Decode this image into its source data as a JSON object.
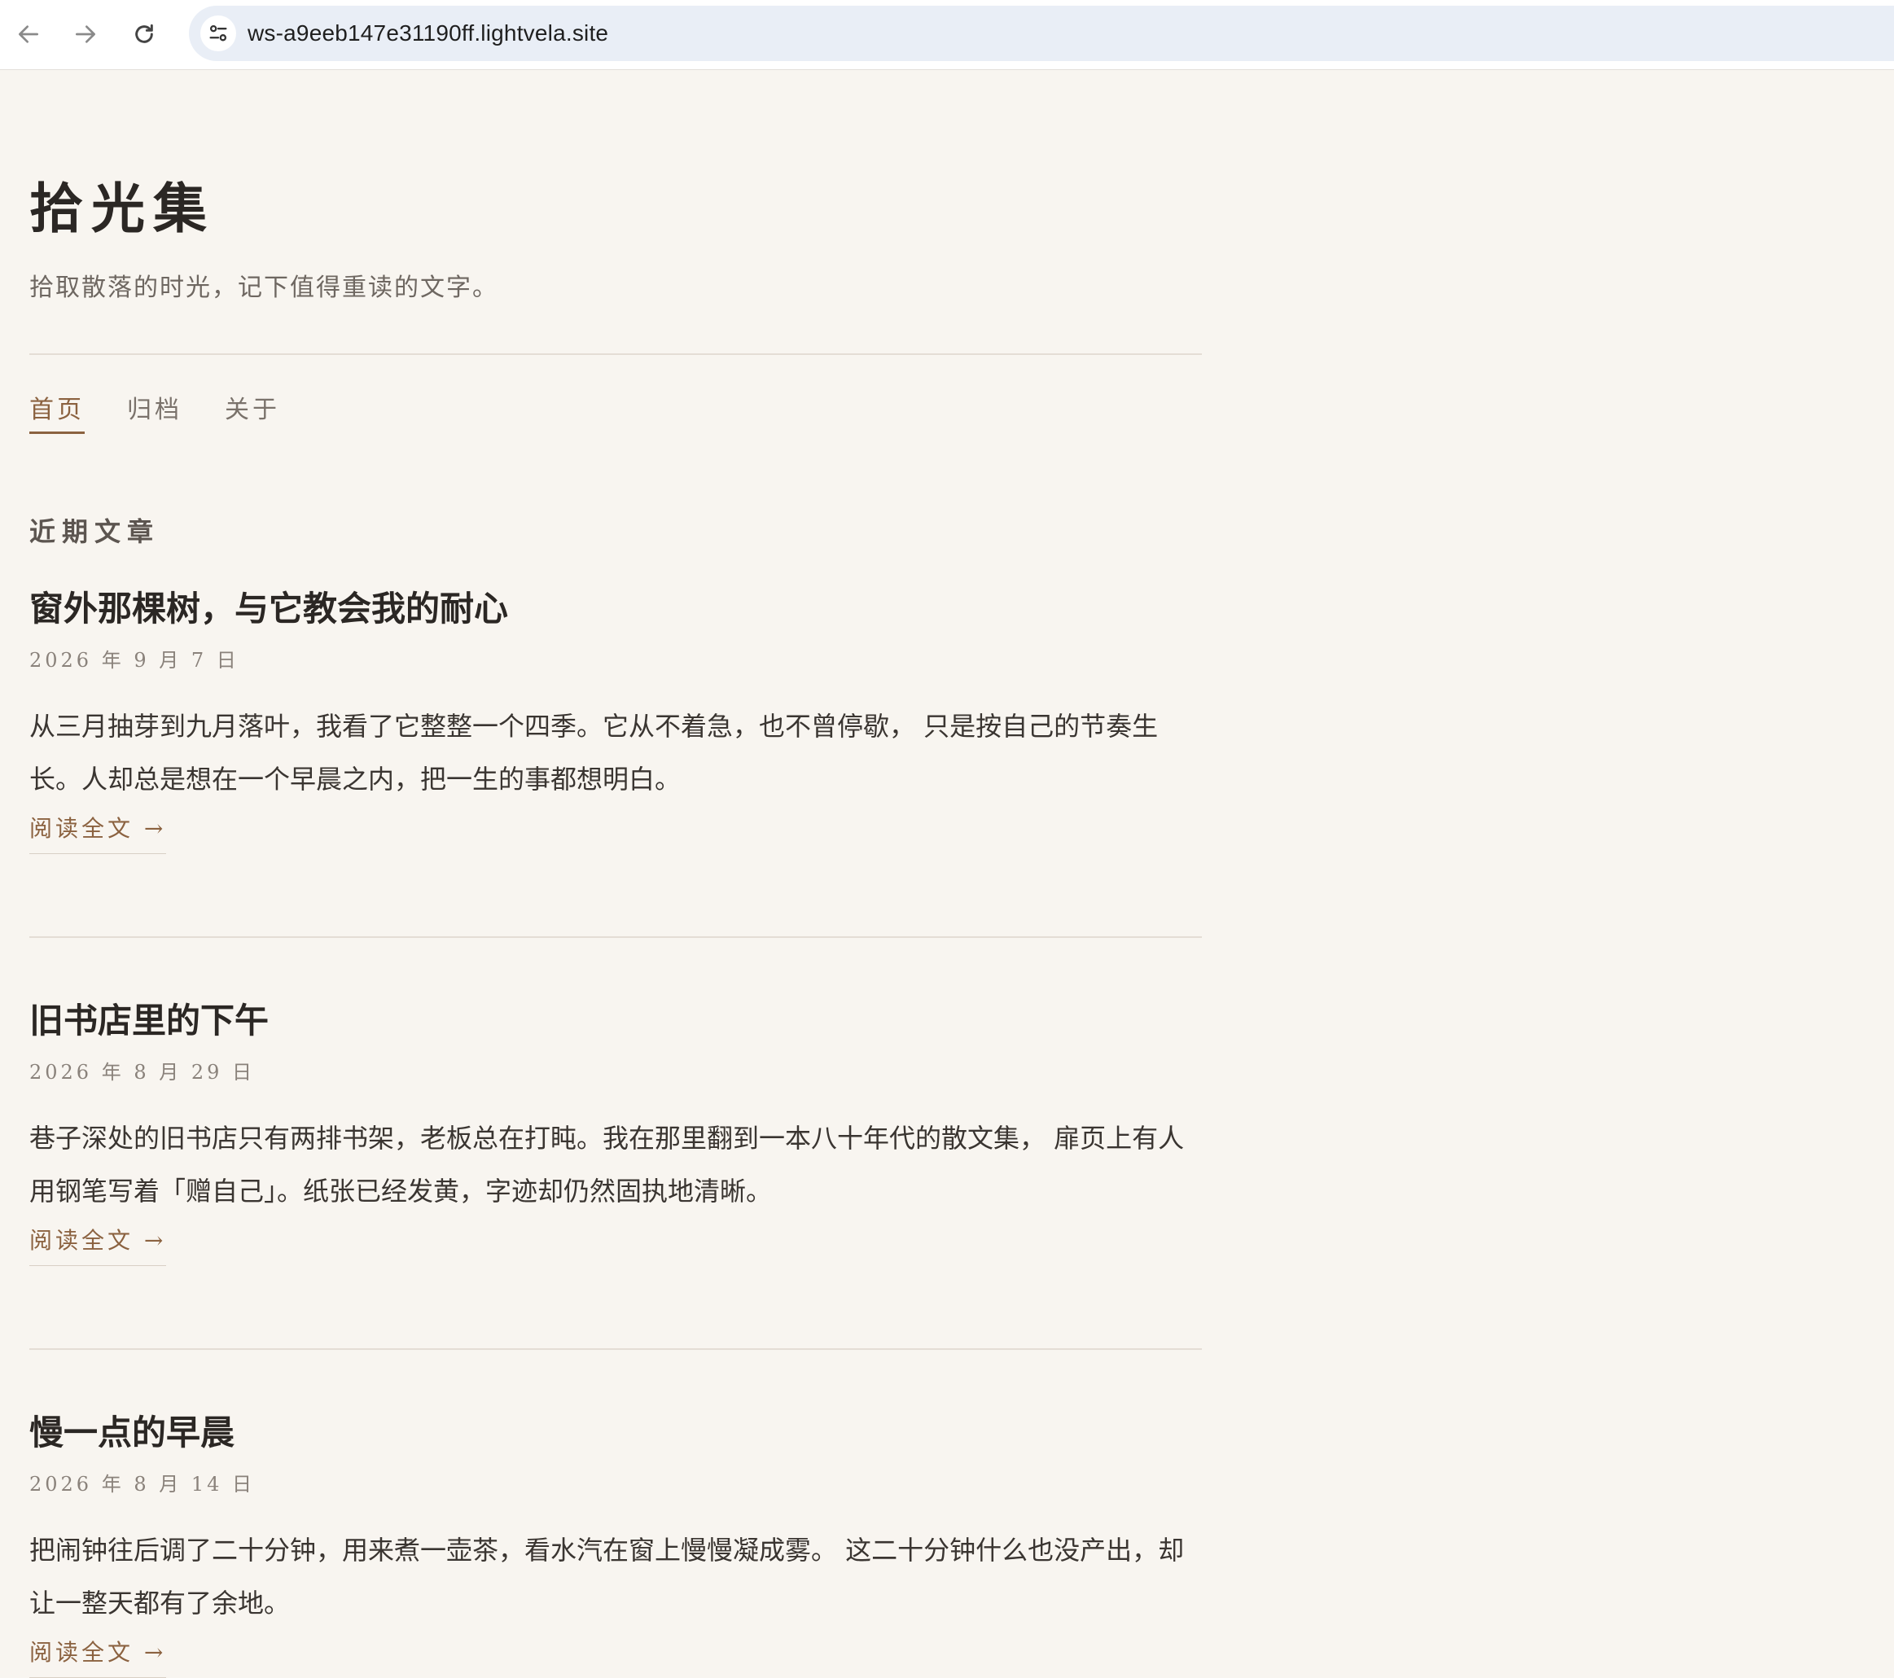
{
  "browser": {
    "url": "ws-a9eeb147e31190ff.lightvela.site"
  },
  "site": {
    "title": "拾光集",
    "tagline": "拾取散落的时光，记下值得重读的文字。"
  },
  "nav": {
    "items": [
      {
        "label": "首页",
        "active": true
      },
      {
        "label": "归档",
        "active": false
      },
      {
        "label": "关于",
        "active": false
      }
    ]
  },
  "section": {
    "heading": "近期文章"
  },
  "posts": [
    {
      "title": "窗外那棵树，与它教会我的耐心",
      "date": "2026 年 9 月 7 日",
      "excerpt": "从三月抽芽到九月落叶，我看了它整整一个四季。它从不着急，也不曾停歇， 只是按自己的节奏生长。人却总是想在一个早晨之内，把一生的事都想明白。",
      "read_more": "阅读全文 →"
    },
    {
      "title": "旧书店里的下午",
      "date": "2026 年 8 月 29 日",
      "excerpt": "巷子深处的旧书店只有两排书架，老板总在打盹。我在那里翻到一本八十年代的散文集， 扉页上有人用钢笔写着「赠自己」。纸张已经发黄，字迹却仍然固执地清晰。",
      "read_more": "阅读全文 →"
    },
    {
      "title": "慢一点的早晨",
      "date": "2026 年 8 月 14 日",
      "excerpt": "把闹钟往后调了二十分钟，用来煮一壶茶，看水汽在窗上慢慢凝成雾。 这二十分钟什么也没产出，却让一整天都有了余地。",
      "read_more": "阅读全文 →"
    }
  ],
  "colors": {
    "background": "#f8f5f0",
    "accent": "#8b6240",
    "text": "#2b2724",
    "muted": "#6e6761",
    "divider": "#e4ddd5"
  }
}
